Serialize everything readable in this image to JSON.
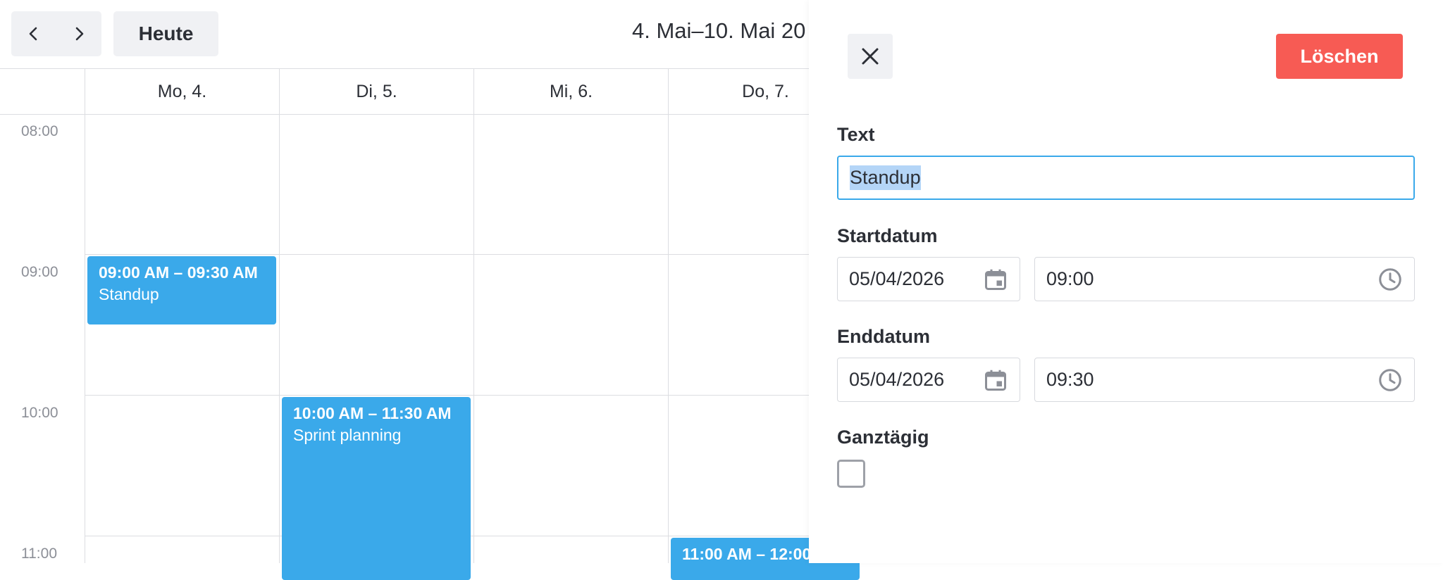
{
  "toolbar": {
    "prev_icon": "chevron-left-icon",
    "next_icon": "chevron-right-icon",
    "today_label": "Heute",
    "date_range": "4. Mai–10. Mai 20"
  },
  "calendar": {
    "days": [
      "Mo, 4.",
      "Di, 5.",
      "Mi, 6.",
      "Do, 7."
    ],
    "times": [
      "08:00",
      "09:00",
      "10:00",
      "11:00"
    ],
    "events": [
      {
        "time": "09:00 AM – 09:30 AM",
        "title": "Standup",
        "color": "#3aa9ea"
      },
      {
        "time": "10:00 AM – 11:30 AM",
        "title": "Sprint planning",
        "color": "#3aa9ea"
      },
      {
        "time": "11:00 AM – 12:00",
        "title": "",
        "color": "#3aa9ea"
      }
    ]
  },
  "panel": {
    "close_icon": "close-icon",
    "delete_label": "Löschen",
    "delete_color": "#f75b54",
    "text_label": "Text",
    "text_value": "Standup",
    "start_label": "Startdatum",
    "start_date": "05/04/2026",
    "start_time": "09:00",
    "end_label": "Enddatum",
    "end_date": "05/04/2026",
    "end_time": "09:30",
    "allday_label": "Ganztägig",
    "allday_checked": false,
    "calendar_icon": "calendar-icon",
    "clock_icon": "clock-icon"
  }
}
